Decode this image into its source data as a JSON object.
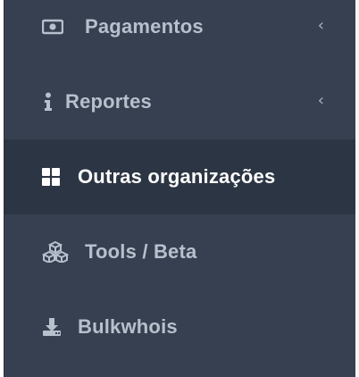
{
  "sidebar": {
    "items": [
      {
        "label": "Pagamentos",
        "icon": "money-icon",
        "chevron": "‹"
      },
      {
        "label": "Reportes",
        "icon": "info-icon",
        "chevron": "‹"
      },
      {
        "label": "Outras organizações",
        "icon": "grid-icon",
        "active": true
      },
      {
        "label": "Tools / Beta",
        "icon": "cubes-icon"
      },
      {
        "label": "Bulkwhois",
        "icon": "download-icon"
      }
    ]
  },
  "colors": {
    "sidebar_bg": "#364050",
    "active_bg": "#2c3543",
    "text": "#b7c0cc",
    "active_text": "#ffffff"
  }
}
